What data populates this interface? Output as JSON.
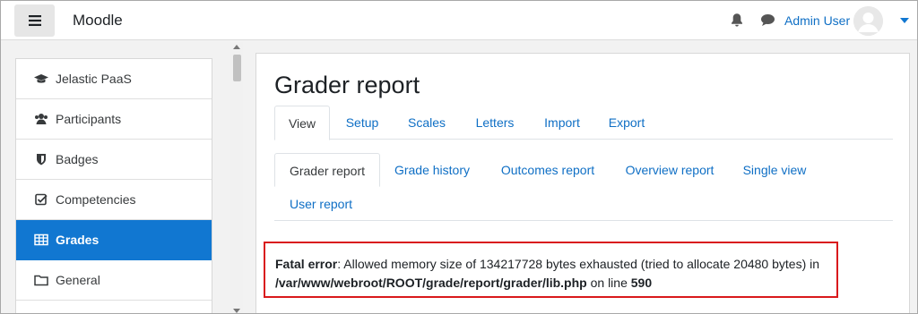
{
  "app": {
    "brand": "Moodle",
    "user_name": "Admin User"
  },
  "drawer": {
    "items": [
      {
        "label": "Jelastic PaaS",
        "icon": "graduation-cap-icon"
      },
      {
        "label": "Participants",
        "icon": "users-icon"
      },
      {
        "label": "Badges",
        "icon": "shield-icon"
      },
      {
        "label": "Competencies",
        "icon": "checkbox-icon"
      },
      {
        "label": "Grades",
        "icon": "table-icon",
        "active": true
      },
      {
        "label": "General",
        "icon": "folder-icon"
      }
    ]
  },
  "main": {
    "title": "Grader report",
    "tabs": [
      {
        "label": "View",
        "active": true
      },
      {
        "label": "Setup"
      },
      {
        "label": "Scales"
      },
      {
        "label": "Letters"
      },
      {
        "label": "Import"
      },
      {
        "label": "Export"
      }
    ],
    "subtabs": [
      {
        "label": "Grader report",
        "active": true
      },
      {
        "label": "Grade history"
      },
      {
        "label": "Outcomes report"
      },
      {
        "label": "Overview report"
      },
      {
        "label": "Single view"
      },
      {
        "label": "User report"
      }
    ],
    "error": {
      "label": "Fatal error",
      "message": ": Allowed memory size of 134217728 bytes exhausted (tried to allocate 20480 bytes) in",
      "path": "/var/www/webroot/ROOT/grade/report/grader/lib.php",
      "on_line": " on line ",
      "line": "590"
    }
  },
  "colors": {
    "accent": "#1177d1",
    "link": "#0f6fc5",
    "error_border": "#d9191c"
  }
}
